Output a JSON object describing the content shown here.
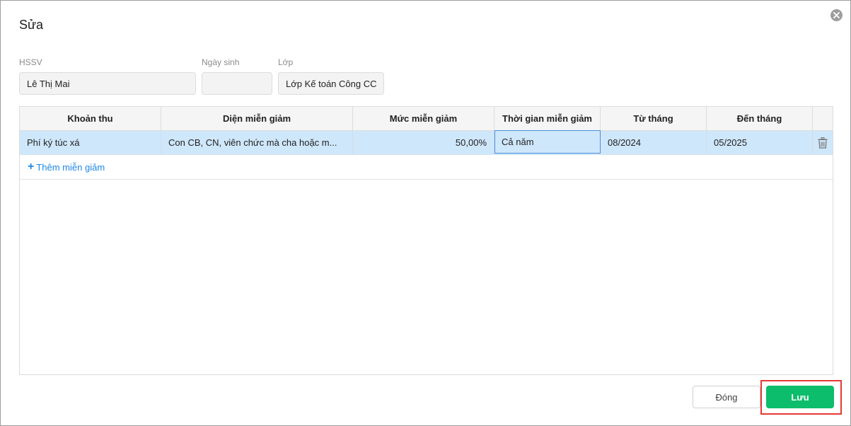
{
  "dialog": {
    "title": "Sửa"
  },
  "form": {
    "student": {
      "label": "HSSV",
      "value": "Lê Thị Mai"
    },
    "birthday": {
      "label": "Ngày sinh",
      "value": ""
    },
    "class": {
      "label": "Lớp",
      "value": "Lớp Kế toán Công CC"
    }
  },
  "table": {
    "columns": [
      "Khoản thu",
      "Diện miễn giảm",
      "Mức miễn giảm",
      "Thời gian miễn giảm",
      "Từ tháng",
      "Đến tháng"
    ],
    "rows": [
      {
        "fee": "Phí ký túc xá",
        "category": "Con CB, CN, viên chức mà cha hoặc m...",
        "rate": "50,00%",
        "period": "Cả năm",
        "from": "08/2024",
        "to": "05/2025"
      }
    ],
    "add_label": "Thêm miễn giảm"
  },
  "footer": {
    "close_label": "Đóng",
    "save_label": "Lưu"
  },
  "colors": {
    "accent": "#1e88e5",
    "save": "#0cbd6b",
    "selected_row": "#cfe7fb",
    "highlight": "#e53935"
  }
}
